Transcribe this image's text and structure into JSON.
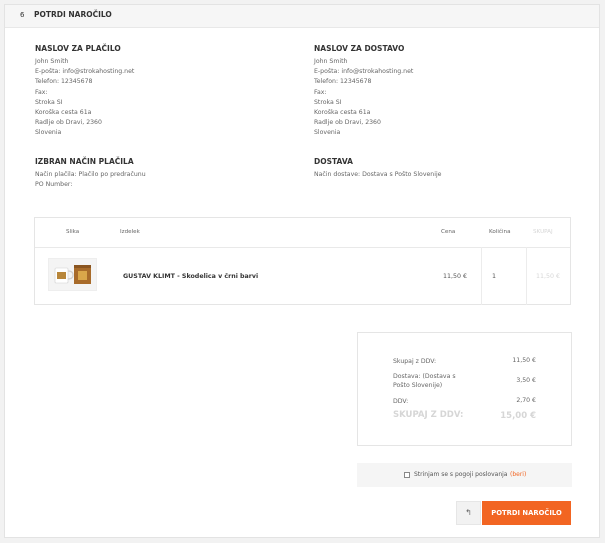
{
  "step": {
    "number": "6",
    "title": "POTRDI NAROČILO"
  },
  "billing": {
    "heading": "NASLOV ZA PLAČILO",
    "lines": [
      "John Smith",
      "E-pošta: info@strokahosting.net",
      "Telefon: 12345678",
      "Fax:",
      "Stroka SI",
      "Koroška cesta 61a",
      "Radlje ob Dravi, 2360",
      "Slovenia"
    ]
  },
  "shipping": {
    "heading": "NASLOV ZA DOSTAVO",
    "lines": [
      "John Smith",
      "E-pošta: info@strokahosting.net",
      "Telefon: 12345678",
      "Fax:",
      "Stroka SI",
      "Koroška cesta 61a",
      "Radlje ob Dravi, 2360",
      "Slovenia"
    ]
  },
  "payment": {
    "heading": "IZBRAN NAČIN PLAČILA",
    "lines": [
      "Način plačila: Plačilo po predračunu",
      "PO Number:"
    ]
  },
  "delivery": {
    "heading": "DOSTAVA",
    "lines": [
      "Način dostave: Dostava s Pošto Slovenije"
    ]
  },
  "cart": {
    "headers": [
      "Slika",
      "Izdelek",
      "Cena",
      "Količina",
      "SKUPAJ"
    ],
    "row": {
      "product": "GUSTAV KLIMT - Skodelica v črni barvi",
      "price": "11,50 €",
      "quantity": "1",
      "total": "11,50 €"
    }
  },
  "totals": {
    "subtotal_label": "Skupaj z DDV:",
    "subtotal_value": "11,50 €",
    "shipping_label": "Dostava: (Dostava s Pošto Slovenije)",
    "shipping_value": "3,50 €",
    "vat_label": "DDV:",
    "vat_value": "2,70 €",
    "grand_label": "SKUPAJ Z DDV:",
    "grand_value": "15,00 €"
  },
  "terms": {
    "text": "Strinjam se s pogoji poslovanja",
    "link": "(beri)"
  },
  "buttons": {
    "back": "↰",
    "confirm": "POTRDI NAROČILO"
  },
  "colors": {
    "accent": "#f26522",
    "muted": "#d6d6d6"
  }
}
